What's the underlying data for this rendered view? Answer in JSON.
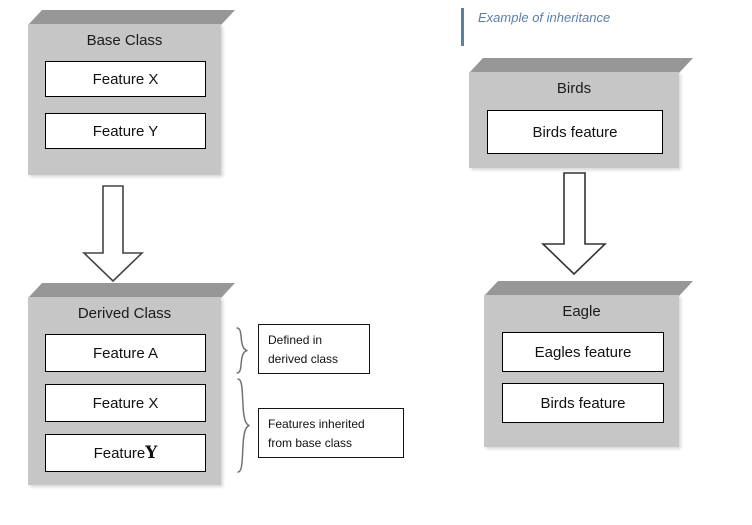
{
  "diagram": {
    "title_caption": "Example of inheritance",
    "background": "#ffffff",
    "box_body_color": "#c6c6c6",
    "box_bevel_color": "#979797",
    "accent_color": "#5b7fa6",
    "arrow_outline_color": "#404040"
  },
  "left_column": {
    "base_class": {
      "title": "Base Class",
      "features": [
        {
          "label": "Feature X"
        },
        {
          "label": "Feature Y"
        }
      ]
    },
    "arrow": {
      "name": "inheritance-arrow-left",
      "direction": "down"
    },
    "derived_class": {
      "title": "Derived Class",
      "features": [
        {
          "label": "Feature A"
        },
        {
          "label": "Feature X"
        },
        {
          "label_prefix": "Feature ",
          "label_suffix": "Y"
        }
      ]
    },
    "notes": [
      {
        "line1": "Defined in",
        "line2": "derived class"
      },
      {
        "line1": "Features inherited",
        "line2": "from base class"
      }
    ]
  },
  "right_column": {
    "base_class": {
      "title": "Birds",
      "features": [
        {
          "label": "Birds feature"
        }
      ]
    },
    "arrow": {
      "name": "inheritance-arrow-right",
      "direction": "down"
    },
    "derived_class": {
      "title": "Eagle",
      "features": [
        {
          "label": "Eagles feature"
        },
        {
          "label": "Birds feature"
        }
      ]
    }
  }
}
